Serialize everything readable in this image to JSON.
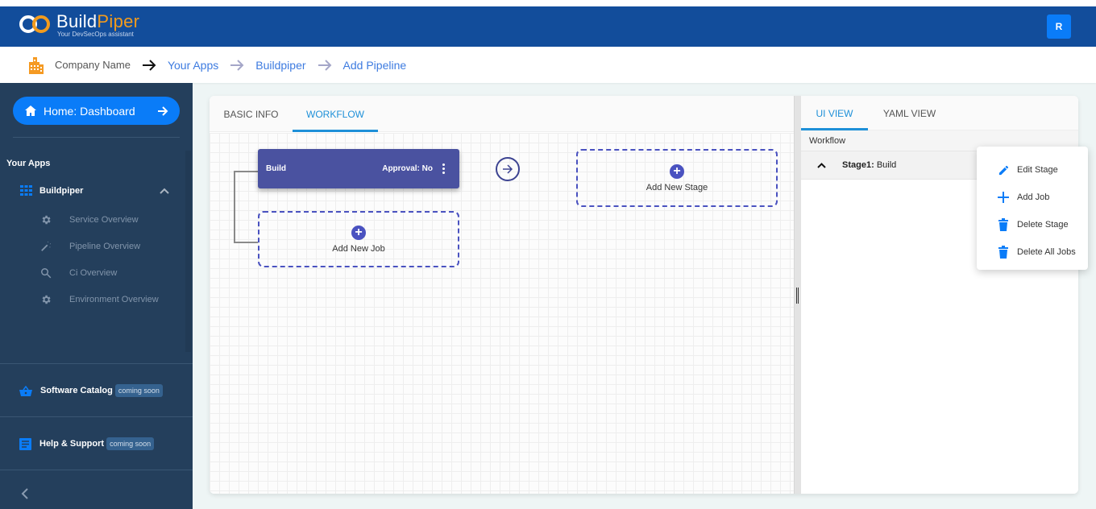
{
  "header": {
    "logo_title_main": "Build",
    "logo_title_accent": "Piper",
    "logo_subtitle": "Your DevSecOps assistant",
    "avatar_initial": "R"
  },
  "breadcrumb": {
    "company": "Company Name",
    "items": [
      "Your Apps",
      "Buildpiper",
      "Add Pipeline"
    ]
  },
  "sidebar": {
    "home_label": "Home: Dashboard",
    "section_title": "Your Apps",
    "app_name": "Buildpiper",
    "sub_items": [
      {
        "label": "Service Overview",
        "icon": "gear-icon"
      },
      {
        "label": "Pipeline Overview",
        "icon": "magic-wand-icon"
      },
      {
        "label": "Ci Overview",
        "icon": "search-icon"
      },
      {
        "label": "Environment Overview",
        "icon": "gear-icon"
      }
    ],
    "software_catalog": {
      "label": "Software Catalog",
      "badge": "coming soon"
    },
    "help_support": {
      "label": "Help & Support",
      "badge": "coming soon"
    }
  },
  "editor": {
    "tabs": [
      {
        "label": "BASIC INFO",
        "active": false
      },
      {
        "label": "WORKFLOW",
        "active": true
      }
    ],
    "stage": {
      "name": "Build",
      "approval": "Approval: No"
    },
    "add_job_label": "Add New Job",
    "add_stage_label": "Add New Stage"
  },
  "view_panel": {
    "tabs": [
      {
        "label": "UI VIEW",
        "active": true
      },
      {
        "label": "YAML VIEW",
        "active": false
      }
    ],
    "workflow_heading": "Workflow",
    "stage_row": {
      "prefix": "Stage1:",
      "name": "Build"
    }
  },
  "context_menu": {
    "items": [
      {
        "label": "Edit Stage",
        "icon": "pencil-icon"
      },
      {
        "label": "Add Job",
        "icon": "plus-icon"
      },
      {
        "label": "Delete Stage",
        "icon": "trash-icon"
      },
      {
        "label": "Delete All Jobs",
        "icon": "trash-icon"
      }
    ]
  },
  "colors": {
    "header_bg": "#124d9b",
    "accent_blue": "#0a7cf8",
    "logo_orange": "#f29b1d",
    "sidebar_bg": "#243f5c",
    "stage_card": "#4a52a0",
    "tab_active": "#1e90d8"
  }
}
